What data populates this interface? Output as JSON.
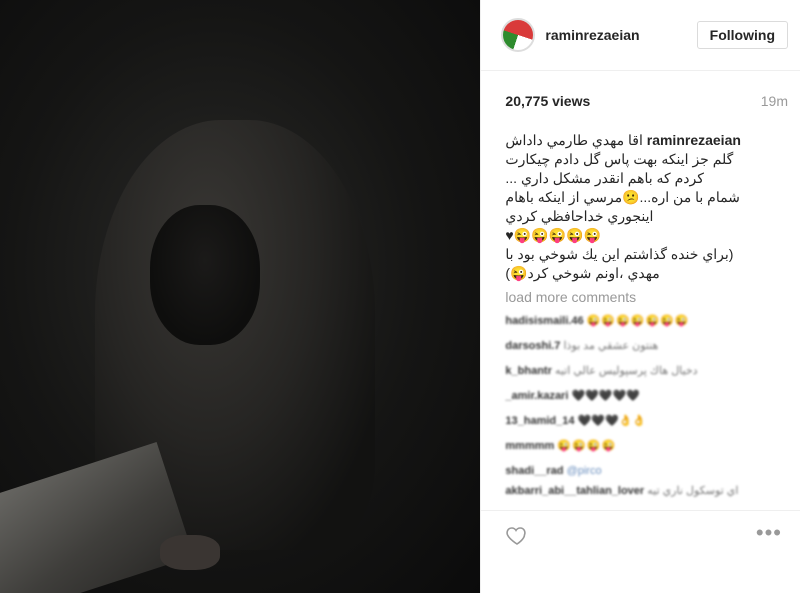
{
  "post": {
    "username": "raminrezaeian",
    "follow_label": "Following",
    "views": "20,775 views",
    "time": "19m",
    "caption_user": "raminrezaeian",
    "caption_lines": [
      "اقا مهدي طارمي داداش",
      "گلم جز اينكه بهت پاس گل دادم چيكارت",
      "كردم كه باهم انقدر مشكل داري ...",
      "شمام با من اره...😕مرسي از اينكه باهام",
      "اينجوري خداحافظي كردي",
      "😜😜😜😜😜♥",
      "(براي خنده گذاشتم اين يك شوخي بود با",
      "مهدي ،اونم شوخي كرد😜)"
    ],
    "load_more": "load more comments"
  },
  "comments": [
    {
      "user": "hadisismaili.46",
      "text": "😜😜😜😜😜😜😜"
    },
    {
      "user": "darsoshi.7",
      "text": "هنتون عشقي مد بوذا"
    },
    {
      "user": "k_bhantr",
      "text": "دخيال هاك پرسپوليس عالي اتيه"
    },
    {
      "user": "_amir.kazari",
      "text": "🖤🖤🖤🖤🖤"
    },
    {
      "user": "13_hamid_14",
      "text": "🖤🖤🖤👌👌"
    },
    {
      "user": "mmmmm",
      "text": "😜😜😜😜"
    },
    {
      "user": "shadi__rad",
      "text": "@pirco"
    },
    {
      "user": "akbarri_abi__tahlian_lover",
      "text": "اي توسكول ناري تيه"
    }
  ],
  "colors": {
    "text": "#262626",
    "muted": "#999999",
    "link": "#6a8fbf"
  },
  "icons": {
    "like": "heart-outline-icon",
    "options": "more-options-icon"
  }
}
